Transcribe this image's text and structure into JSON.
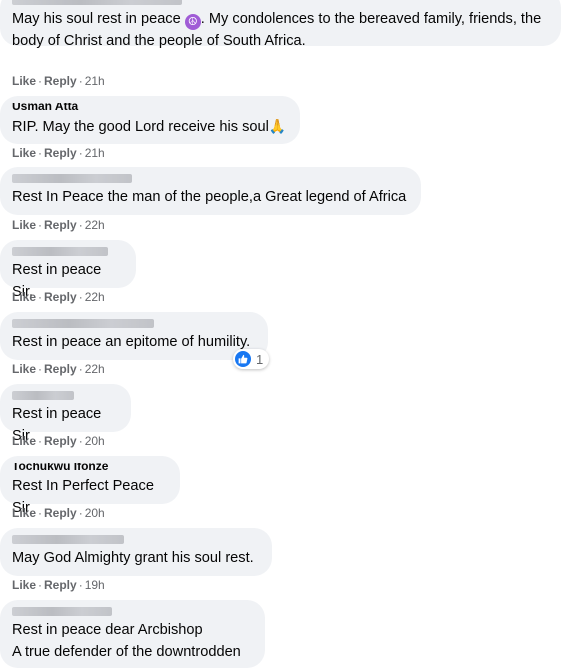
{
  "actions": {
    "like_label": "Like",
    "reply_label": "Reply",
    "separator": "·"
  },
  "colors": {
    "bubble": "#f0f2f5",
    "meta": "#65676b",
    "text": "#050505",
    "like_blue": "#1877f2",
    "peace_purple": "#a05cd6"
  },
  "comments": [
    {
      "author": "",
      "text_before": "May his soul rest in peace ",
      "emoji": "peace-icon",
      "text": ". My condolences to the bereaved family, friends, the\nbody of Christ and the people of South Africa.",
      "time": "21h"
    },
    {
      "author": "Usman Atta",
      "text": "RIP. May the good Lord receive his soul",
      "emoji": "folded-hands-icon",
      "time": "21h"
    },
    {
      "author": "",
      "text": "Rest In Peace the man of the people,a Great legend of Africa",
      "time": "22h"
    },
    {
      "author": "",
      "text": "Rest in peace Sir.",
      "time": "22h"
    },
    {
      "author": "",
      "text": "Rest in peace an epitome of humility.",
      "time": "22h",
      "reaction_count": "1"
    },
    {
      "author": "",
      "text": "Rest in peace Sir",
      "time": "20h"
    },
    {
      "author": "Tochukwu Ifonze",
      "text": "Rest In Perfect Peace Sir",
      "time": "20h"
    },
    {
      "author": "",
      "text": "May God Almighty grant his soul rest.",
      "time": "19h"
    },
    {
      "author": "",
      "text": "Rest in peace dear Arcbishop\nA true defender of the downtrodden"
    }
  ]
}
